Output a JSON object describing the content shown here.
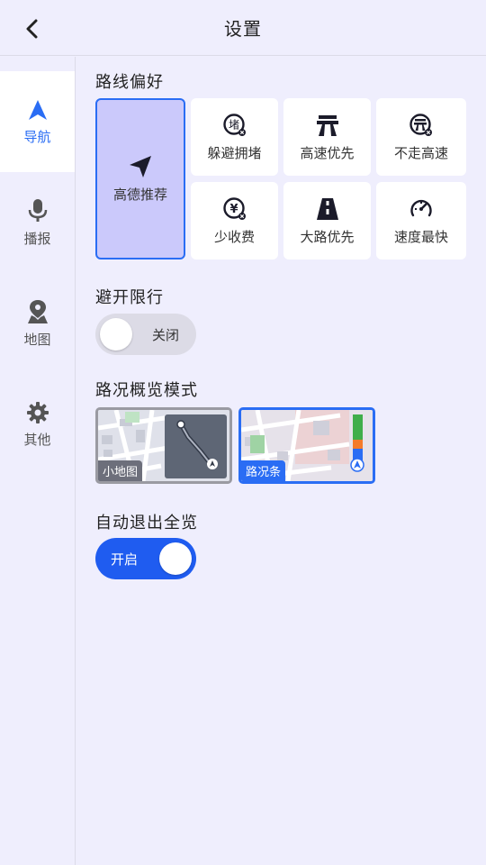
{
  "header": {
    "title": "设置"
  },
  "sidebar": {
    "items": [
      {
        "label": "导航",
        "icon": "navigation-arrow-icon",
        "active": true
      },
      {
        "label": "播报",
        "icon": "microphone-icon"
      },
      {
        "label": "地图",
        "icon": "map-pin-icon"
      },
      {
        "label": "其他",
        "icon": "gear-icon"
      }
    ]
  },
  "route_pref": {
    "title": "路线偏好",
    "options": [
      {
        "label": "高德推荐",
        "icon": "paper-plane-icon",
        "selected": true
      },
      {
        "label": "躲避拥堵",
        "icon": "avoid-congestion-icon"
      },
      {
        "label": "高速优先",
        "icon": "highway-icon"
      },
      {
        "label": "不走高速",
        "icon": "no-highway-icon"
      },
      {
        "label": "少收费",
        "icon": "less-toll-icon"
      },
      {
        "label": "大路优先",
        "icon": "main-road-icon"
      },
      {
        "label": "速度最快",
        "icon": "speedometer-icon"
      }
    ]
  },
  "restriction": {
    "title": "避开限行",
    "toggle_label": "关闭",
    "state": "off"
  },
  "overview_mode": {
    "title": "路况概览模式",
    "options": [
      {
        "label": "小地图",
        "selected": false
      },
      {
        "label": "路况条",
        "selected": true
      }
    ]
  },
  "auto_exit": {
    "title": "自动退出全览",
    "toggle_label": "开启",
    "state": "on"
  },
  "colors": {
    "accent": "#2a6df4",
    "selected_bg": "#cbc9fb",
    "page_bg": "#efeefd"
  }
}
